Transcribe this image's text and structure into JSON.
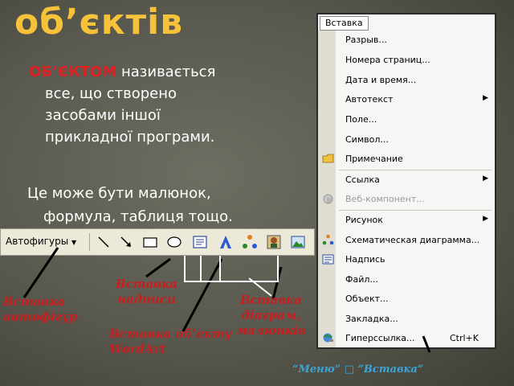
{
  "slide": {
    "title": "об’єктів",
    "para1": {
      "keyword": "ОБ’ЄКТОМ",
      "line1_rest": " називається",
      "line2": "все, що створено",
      "line3": "засобами іншої",
      "line4": "прикладної програми."
    },
    "para2": {
      "line1": "Це може бути малюнок,",
      "line2": "формула, таблиця тощо."
    }
  },
  "toolbar": {
    "autoshapes_label": "Автофигуры",
    "icons": [
      "line-icon",
      "arrow-icon",
      "rectangle-icon",
      "oval-icon",
      "textbox-icon",
      "wordart-icon",
      "diagram-icon",
      "clipart-icon",
      "picture-icon"
    ]
  },
  "menu": {
    "header": "Вставка",
    "items": [
      {
        "label": "Разрыв..."
      },
      {
        "label": "Номера страниц..."
      },
      {
        "label": "Дата и время..."
      },
      {
        "label": "Автотекст",
        "arrow": "▶"
      },
      {
        "label": "Поле..."
      },
      {
        "label": "Символ..."
      },
      {
        "label": "Примечание",
        "icon": "comment-icon"
      },
      {
        "label": "Ссылка",
        "arrow": "▶"
      },
      {
        "label": "Веб-компонент...",
        "icon": "web-component-icon",
        "disabled": true
      },
      {
        "label": "Рисунок",
        "arrow": "▶"
      },
      {
        "label": "Схематическая диаграмма...",
        "icon": "diagram-icon"
      },
      {
        "label": "Надпись",
        "icon": "textbox-icon"
      },
      {
        "label": "Файл..."
      },
      {
        "label": "Объект..."
      },
      {
        "label": "Закладка..."
      },
      {
        "label": "Гиперссылка...",
        "shortcut": "Ctrl+K",
        "icon": "hyperlink-icon"
      }
    ]
  },
  "annotations": {
    "autoshapes": [
      "Вставка",
      "автофігур"
    ],
    "textbox": [
      "Вставка",
      "надписи"
    ],
    "wordart": [
      "Вставка об’єкту",
      "WordArt"
    ],
    "diagram": [
      "Вставка",
      "діаграм,",
      "малюнків"
    ],
    "caption": "“Меню” □ ”Вставка”"
  },
  "colors": {
    "title": "#f5c23a",
    "keyword": "#e02020",
    "annotation": "#c81e1e",
    "caption": "#3aa6d8"
  }
}
